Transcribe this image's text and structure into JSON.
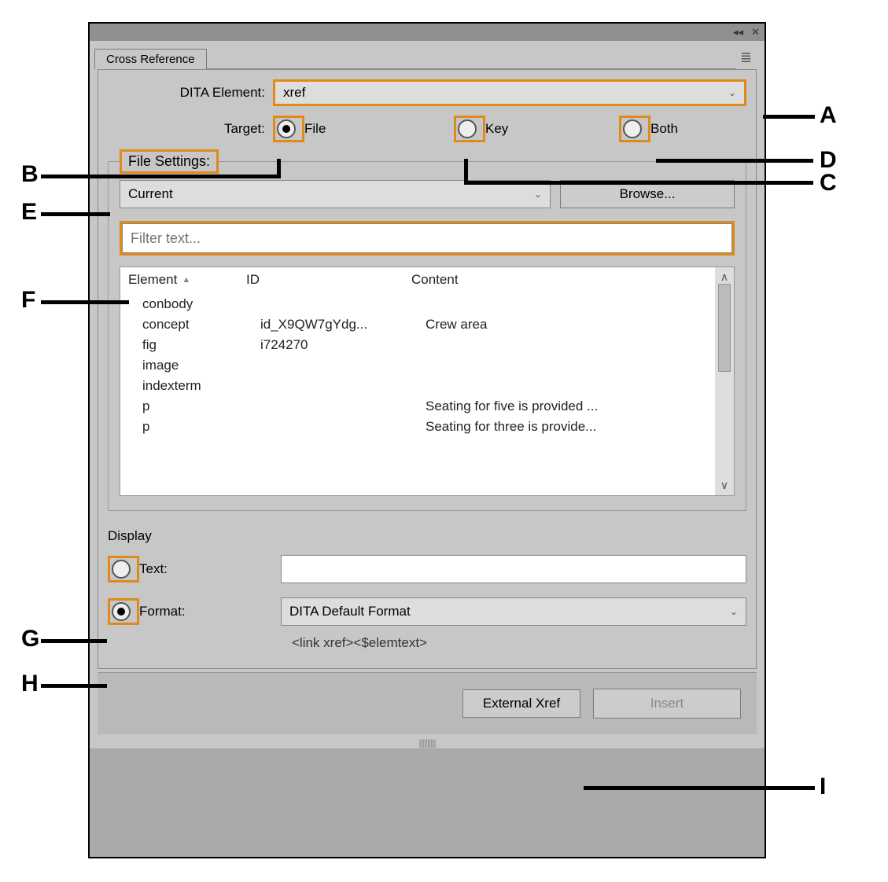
{
  "tab_title": "Cross Reference",
  "dita_label": "DITA Element:",
  "dita_value": "xref",
  "target_label": "Target:",
  "target_options": {
    "file": "File",
    "key": "Key",
    "both": "Both"
  },
  "file_settings_label": "File Settings:",
  "file_select_value": "Current",
  "browse_label": "Browse...",
  "filter_placeholder": "Filter text...",
  "table": {
    "headers": {
      "element": "Element",
      "id": "ID",
      "content": "Content"
    },
    "rows": [
      {
        "element": "conbody",
        "id": "",
        "content": ""
      },
      {
        "element": "concept",
        "id": "id_X9QW7gYdg...",
        "content": "Crew area"
      },
      {
        "element": "fig",
        "id": "i724270",
        "content": ""
      },
      {
        "element": "image",
        "id": "",
        "content": ""
      },
      {
        "element": "indexterm",
        "id": "",
        "content": ""
      },
      {
        "element": "p",
        "id": "",
        "content": "Seating for five is provided ..."
      },
      {
        "element": "p",
        "id": "",
        "content": "Seating for three is provide..."
      }
    ]
  },
  "display": {
    "section_title": "Display",
    "text_label": "Text:",
    "format_label": "Format:",
    "format_value": "DITA Default Format",
    "format_example": "<link xref><$elemtext>"
  },
  "buttons": {
    "external_xref": "External Xref",
    "insert": "Insert"
  },
  "callouts": {
    "A": "A",
    "B": "B",
    "C": "C",
    "D": "D",
    "E": "E",
    "F": "F",
    "G": "G",
    "H": "H",
    "I": "I"
  }
}
